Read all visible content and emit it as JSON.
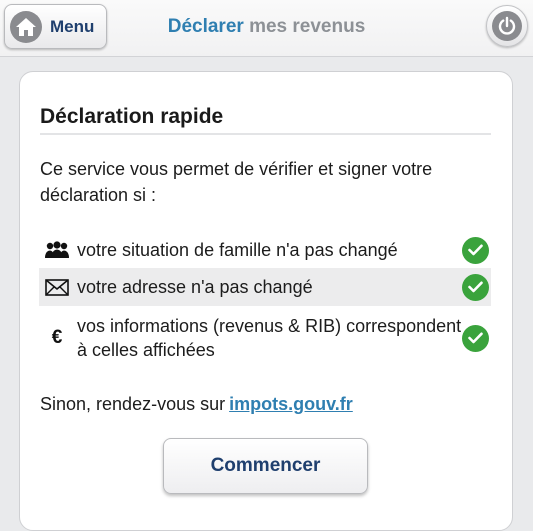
{
  "header": {
    "menu_label": "Menu",
    "title_part1": "Déclarer",
    "title_part2": "mes revenus",
    "menu_icon": "home-icon",
    "power_icon": "power-icon"
  },
  "card": {
    "title": "Déclaration rapide",
    "intro": "Ce service vous permet de vérifier et signer votre déclaration si :",
    "conditions": [
      {
        "icon": "family-icon",
        "text": "votre situation de famille n'a pas changé",
        "status": "check-icon"
      },
      {
        "icon": "envelope-icon",
        "text": "votre adresse n'a pas changé",
        "status": "check-icon"
      },
      {
        "icon": "euro-icon",
        "symbol": "€",
        "text": "vos informations (revenus & RIB) correspondent à celles affichées",
        "status": "check-icon"
      }
    ],
    "otherwise_text": "Sinon, rendez-vous sur",
    "link_text": "impots.gouv.fr",
    "start_button": "Commencer"
  },
  "colors": {
    "accent_blue": "#2f7fb1",
    "navy": "#1f3f6e",
    "check_green": "#3aa33c",
    "icon_grey": "#8a8b8f"
  }
}
